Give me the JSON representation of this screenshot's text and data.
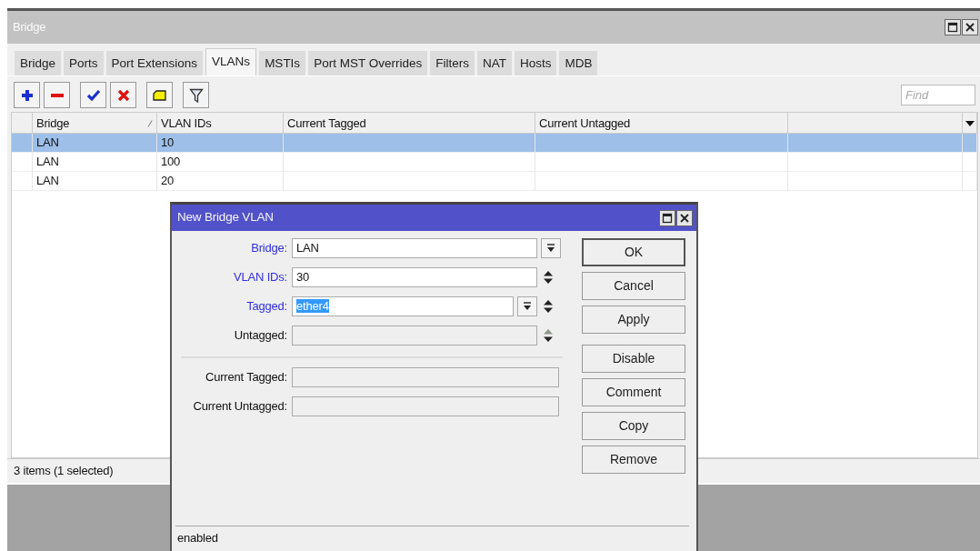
{
  "window": {
    "title": "Bridge"
  },
  "tabs": [
    {
      "label": "Bridge",
      "selected": false
    },
    {
      "label": "Ports",
      "selected": false
    },
    {
      "label": "Port Extensions",
      "selected": false
    },
    {
      "label": "VLANs",
      "selected": true
    },
    {
      "label": "MSTIs",
      "selected": false
    },
    {
      "label": "Port MST Overrides",
      "selected": false
    },
    {
      "label": "Filters",
      "selected": false
    },
    {
      "label": "NAT",
      "selected": false
    },
    {
      "label": "Hosts",
      "selected": false
    },
    {
      "label": "MDB",
      "selected": false
    }
  ],
  "find": {
    "placeholder": "Find"
  },
  "table": {
    "columns": [
      "Bridge",
      "VLAN IDs",
      "Current Tagged",
      "Current Untagged"
    ],
    "rows": [
      {
        "cells": [
          "LAN",
          "10"
        ],
        "selected": true
      },
      {
        "cells": [
          "LAN",
          "100"
        ],
        "selected": false
      },
      {
        "cells": [
          "LAN",
          "20"
        ],
        "selected": false
      }
    ]
  },
  "status_bar": "3 items (1 selected)",
  "dialog": {
    "title": "New Bridge VLAN",
    "fields": [
      {
        "label": "Bridge:",
        "value": "LAN",
        "kind": "select",
        "emphasized": true,
        "disabled": false,
        "selected": false
      },
      {
        "label": "VLAN IDs:",
        "value": "30",
        "kind": "spin",
        "emphasized": true,
        "disabled": false,
        "selected": false
      },
      {
        "label": "Tagged:",
        "value": "ether4",
        "kind": "select_spin",
        "emphasized": true,
        "disabled": false,
        "selected": true
      },
      {
        "label": "Untagged:",
        "kind": "spin",
        "emphasized": false,
        "disabled": true,
        "selected": false
      },
      {
        "kind": "separator"
      },
      {
        "label": "Current Tagged:",
        "kind": "readonly",
        "emphasized": false,
        "disabled": true,
        "selected": false
      },
      {
        "label": "Current Untagged:",
        "kind": "readonly",
        "emphasized": false,
        "disabled": true,
        "selected": false
      }
    ],
    "button_groups": [
      [
        {
          "label": "OK",
          "default": true
        },
        {
          "label": "Cancel",
          "default": false
        },
        {
          "label": "Apply",
          "default": false
        }
      ],
      [
        {
          "label": "Disable",
          "default": false
        },
        {
          "label": "Comment",
          "default": false
        },
        {
          "label": "Copy",
          "default": false
        },
        {
          "label": "Remove",
          "default": false
        }
      ]
    ],
    "status": "enabled"
  }
}
